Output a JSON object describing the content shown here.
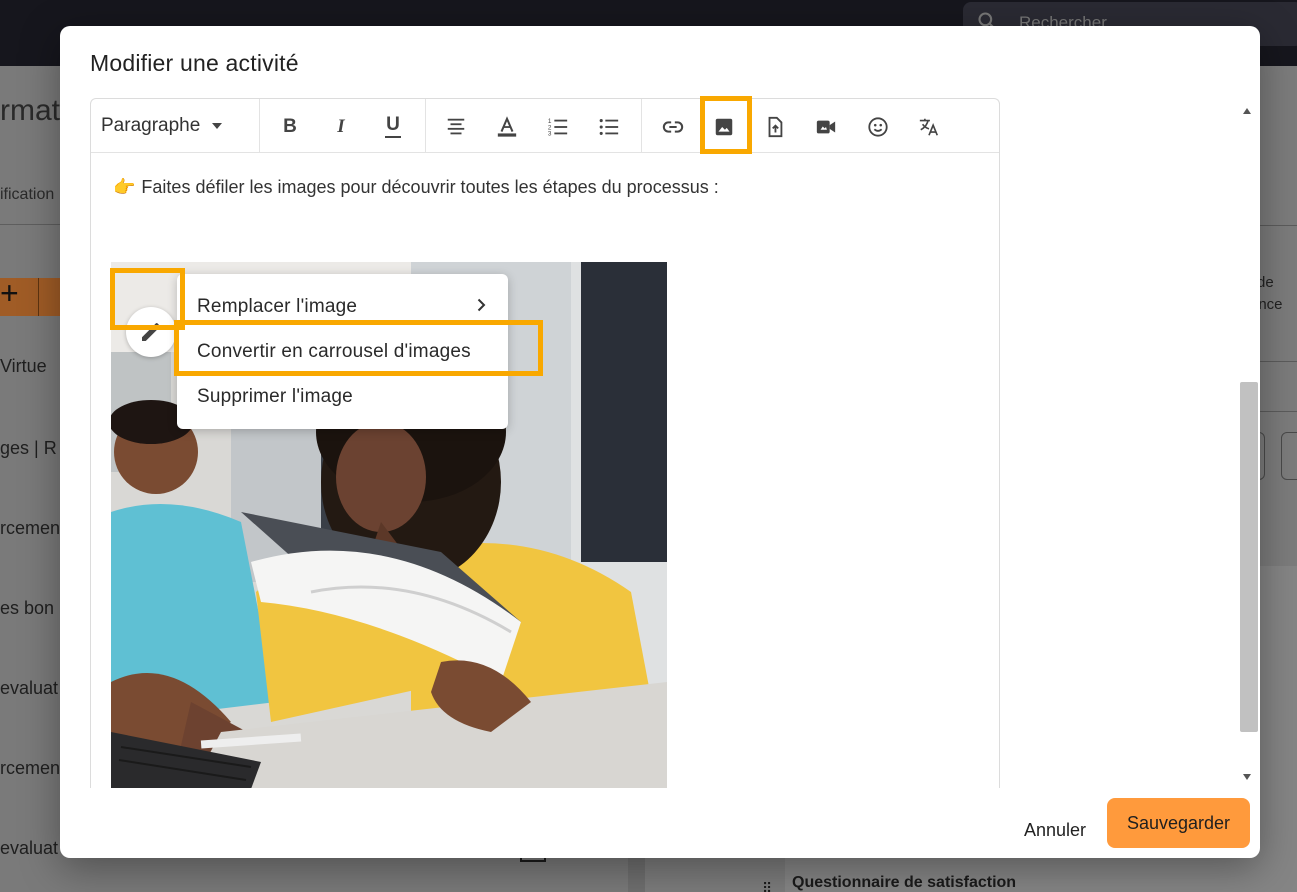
{
  "background": {
    "search_placeholder": "Rechercher",
    "page_title": "rmat",
    "subtab": "ification",
    "left_items": [
      "Virtue",
      "ges | R",
      "rcemen",
      "es bon",
      "evaluat",
      "rcemen",
      "evaluat"
    ],
    "right_text_1": "de",
    "right_text_2": "ance",
    "bottom_item": "Questionnaire de satisfaction"
  },
  "modal": {
    "title": "Modifier une activité",
    "toolbar": {
      "paragraph_label": "Paragraphe",
      "icons": [
        "bold-icon",
        "italic-icon",
        "underline-icon",
        "align-icon",
        "text-color-icon",
        "ordered-list-icon",
        "bullet-list-icon",
        "link-icon",
        "image-icon",
        "file-upload-icon",
        "video-icon",
        "emoji-icon",
        "translate-icon"
      ],
      "bold": "B",
      "italic": "I",
      "underline": "U"
    },
    "content": {
      "intro_emoji": "👉",
      "intro_text": "Faites défiler les images pour découvrir toutes les étapes du processus :"
    },
    "image_menu": {
      "replace": "Remplacer l'image",
      "convert": "Convertir en carrousel d'images",
      "delete": "Supprimer l'image"
    },
    "cancel_label": "Annuler",
    "save_label": "Sauvegarder"
  },
  "colors": {
    "highlight": "#f9a800",
    "save_button": "#ff9a3c"
  }
}
